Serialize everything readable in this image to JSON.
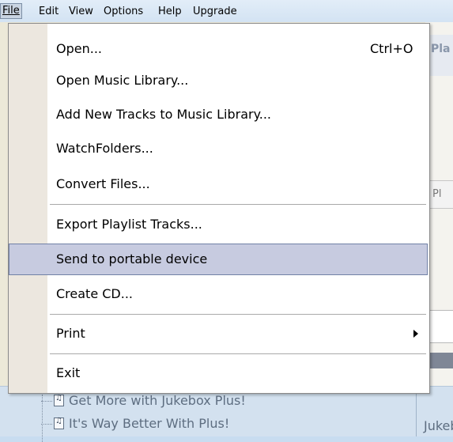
{
  "menubar": {
    "items": [
      {
        "label": "File"
      },
      {
        "label": "Edit"
      },
      {
        "label": "View"
      },
      {
        "label": "Options"
      },
      {
        "label": "Help"
      },
      {
        "label": "Upgrade"
      }
    ]
  },
  "background": {
    "panel_top_label": "Pla",
    "panel_mid_label": "Pl",
    "tree_items": [
      {
        "label": "Get More with Jukebox Plus!"
      },
      {
        "label": "It's Way Better With Plus!"
      }
    ],
    "tree_right_label": "Jukeb"
  },
  "file_menu": {
    "items": [
      {
        "label": "Open...",
        "shortcut": "Ctrl+O"
      },
      {
        "label": "Open Music Library..."
      },
      {
        "label": "Add New Tracks to Music Library..."
      },
      {
        "label": "WatchFolders..."
      },
      {
        "label": "Convert Files..."
      },
      {
        "label": "Export Playlist Tracks..."
      },
      {
        "label": "Send to portable device",
        "highlighted": true
      },
      {
        "label": "Create CD..."
      },
      {
        "label": "Print",
        "submenu": true
      },
      {
        "label": "Exit"
      }
    ]
  }
}
